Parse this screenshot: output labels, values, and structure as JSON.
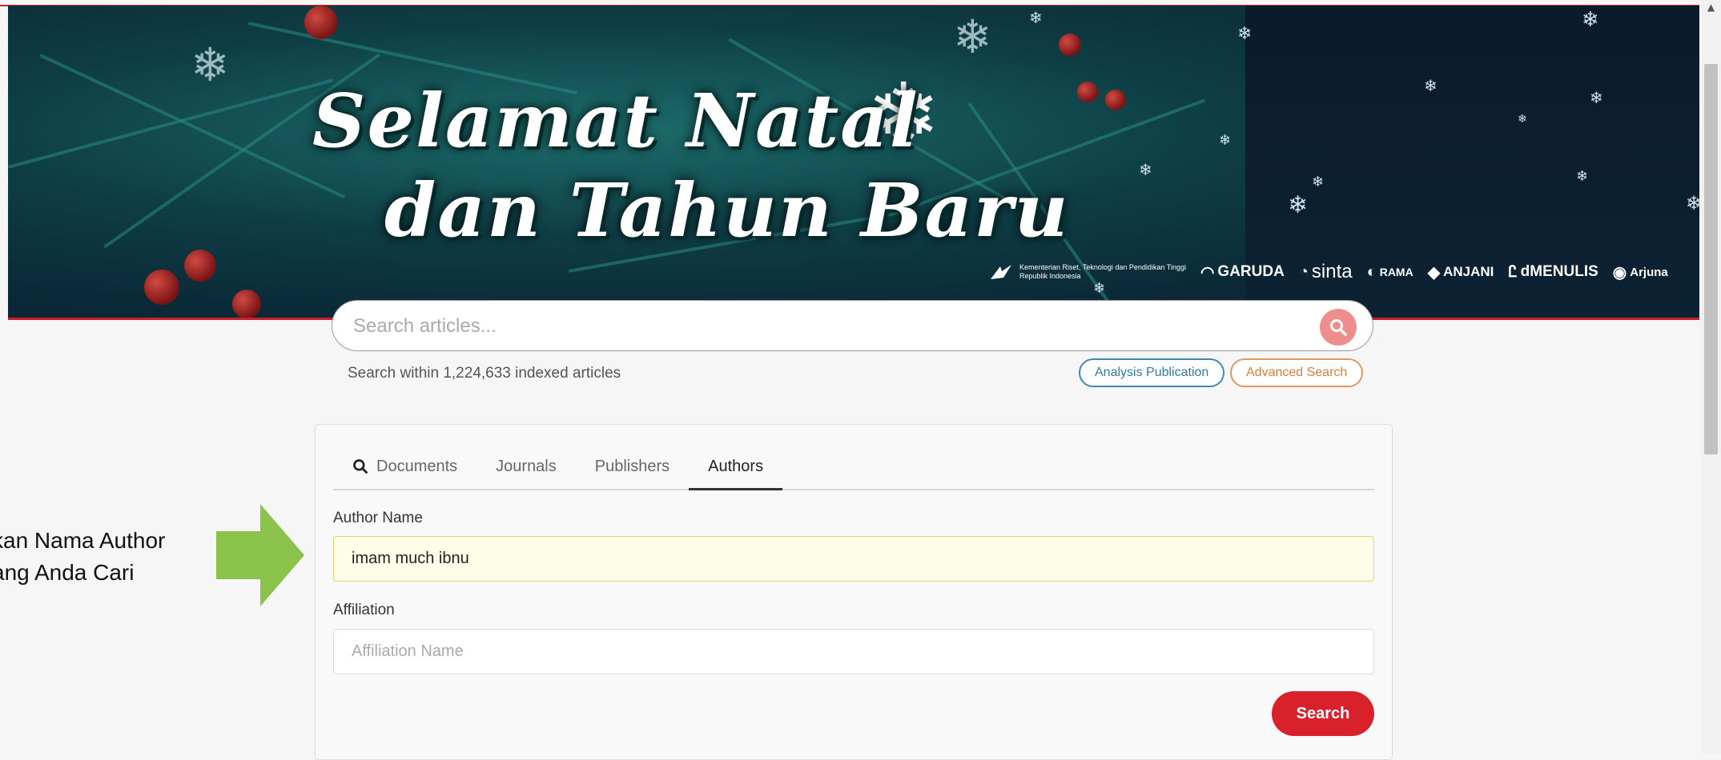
{
  "banner": {
    "greeting_line1": "Selamat Natal",
    "greeting_line2": "dan Tahun Baru",
    "ministry_name": "Kementerian Riset, Teknologi dan Pendidikan Tinggi",
    "ministry_sub": "Republik Indonesia",
    "logos": [
      "GARUDA",
      "sinta",
      "RAMA",
      "ANJANI",
      "dMENULIS",
      "Arjuna"
    ]
  },
  "search": {
    "placeholder": "Search articles...",
    "within_text": "Search within 1,224,633 indexed articles",
    "analysis_label": "Analysis Publication",
    "advanced_label": "Advanced Search"
  },
  "tabs": [
    {
      "label": "Documents",
      "active": false
    },
    {
      "label": "Journals",
      "active": false
    },
    {
      "label": "Publishers",
      "active": false
    },
    {
      "label": "Authors",
      "active": true
    }
  ],
  "form": {
    "author_label": "Author Name",
    "author_value": "imam much ibnu",
    "affiliation_label": "Affiliation",
    "affiliation_placeholder": "Affiliation Name",
    "submit_label": "Search"
  },
  "annotation": {
    "line1": "kan Nama Author",
    "line2": "ang Anda Cari"
  },
  "colors": {
    "accent_red": "#d8212b",
    "search_icon_bg": "#ef8d8d",
    "analysis_blue": "#2f79a6",
    "advanced_orange": "#d87d3a",
    "arrow_green": "#8bc34a"
  }
}
